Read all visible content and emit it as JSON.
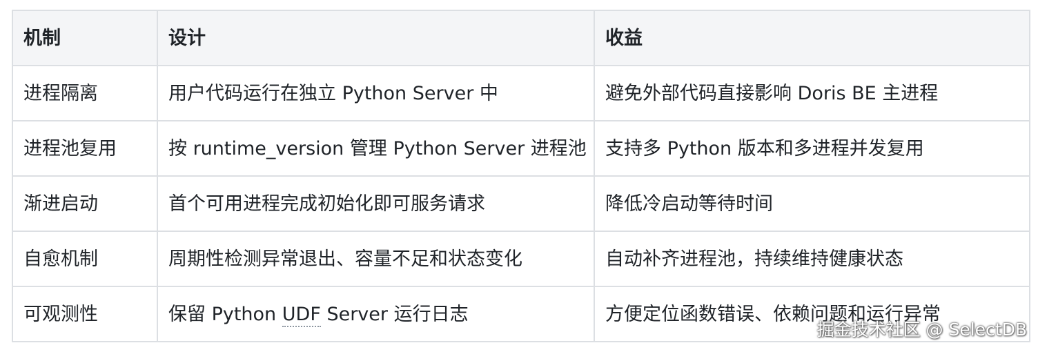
{
  "table": {
    "headers": [
      "机制",
      "设计",
      "收益"
    ],
    "rows": [
      {
        "mechanism": "进程隔离",
        "design": "用户代码运行在独立 Python Server 中",
        "benefit": "避免外部代码直接影响 Doris BE 主进程"
      },
      {
        "mechanism": "进程池复用",
        "design": "按 runtime_version 管理 Python Server 进程池",
        "benefit": "支持多 Python 版本和多进程并发复用"
      },
      {
        "mechanism": "渐进启动",
        "design": "首个可用进程完成初始化即可服务请求",
        "benefit": "降低冷启动等待时间"
      },
      {
        "mechanism": "自愈机制",
        "design": "周期性检测异常退出、容量不足和状态变化",
        "benefit": "自动补齐进程池，持续维持健康状态"
      },
      {
        "mechanism": "可观测性",
        "design_pre": "保留 Python ",
        "design_abbr": "UDF",
        "design_post": " Server 运行日志",
        "benefit": "方便定位函数错误、依赖问题和运行异常"
      }
    ]
  },
  "watermark": "掘金技术社区 @ SelectDB"
}
